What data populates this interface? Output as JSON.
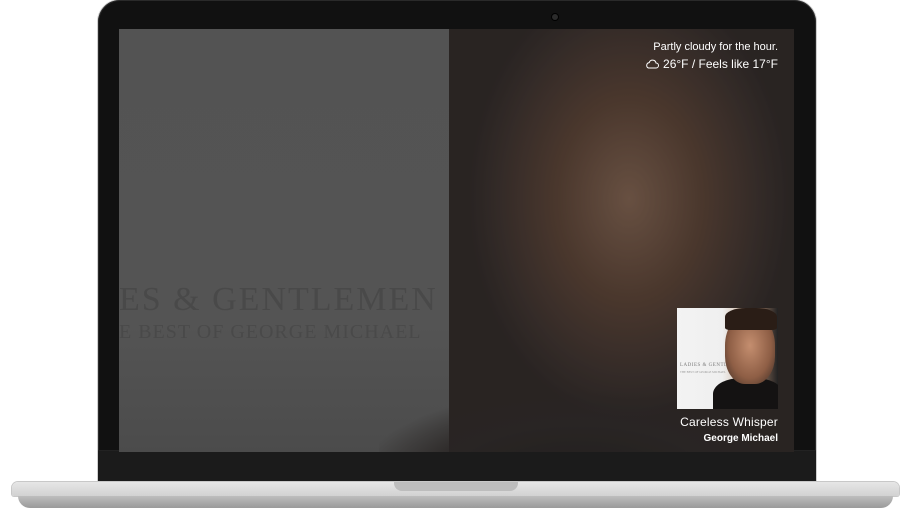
{
  "weather": {
    "summary": "Partly cloudy for the hour.",
    "temperature": "26°F / Feels like 17°F",
    "icon": "cloud-icon"
  },
  "now_playing": {
    "title": "Careless Whisper",
    "artist": "George Michael",
    "album_art_lines": [
      "LADIES & GENTLEMEN",
      "THE BEST OF GEORGE MICHAEL"
    ]
  },
  "background": {
    "album_title_fragment": "ES & GENTLEMEN",
    "album_subtitle_fragment": "E BEST OF GEORGE MICHAEL"
  },
  "colors": {
    "screen_text": "#ffffff",
    "lid": "#111111",
    "base": "#d2d2d2"
  }
}
